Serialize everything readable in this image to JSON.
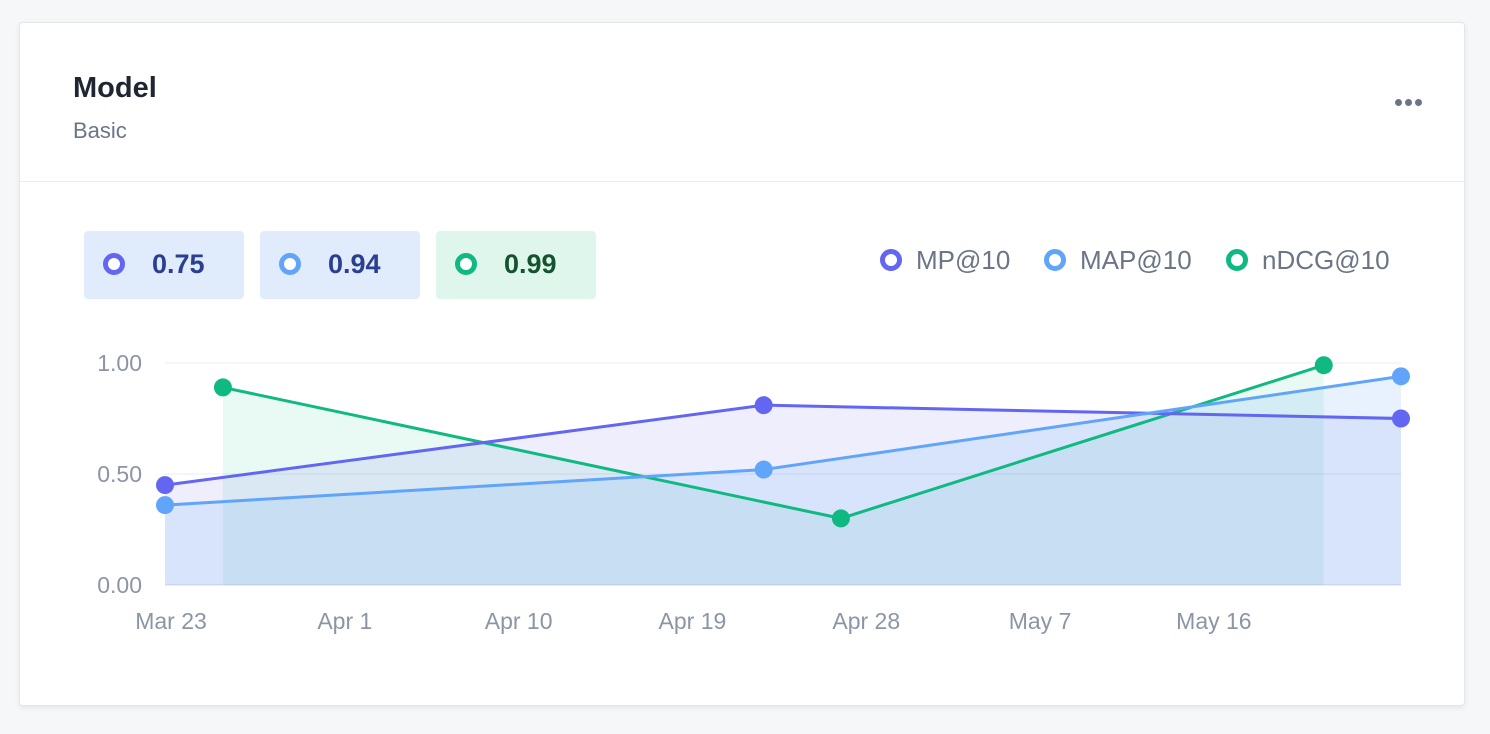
{
  "header": {
    "title": "Model",
    "subtitle": "Basic",
    "more_icon": "more-horizontal-icon"
  },
  "stat_pills": [
    {
      "value": "0.75",
      "color": "#6366f1",
      "bg": "#e0ebfb",
      "text_color": "#2a3f8f"
    },
    {
      "value": "0.94",
      "color": "#60a5fa",
      "bg": "#e0ebfb",
      "text_color": "#2a3f8f"
    },
    {
      "value": "0.99",
      "color": "#10b981",
      "bg": "#dff6ec",
      "text_color": "#14532d"
    }
  ],
  "legend": [
    {
      "label": "MP@10",
      "color": "#6366f1"
    },
    {
      "label": "MAP@10",
      "color": "#60a5fa"
    },
    {
      "label": "nDCG@10",
      "color": "#10b981"
    }
  ],
  "chart_data": {
    "type": "area",
    "x_ticks": [
      "Mar 23",
      "Apr 1",
      "Apr 10",
      "Apr 19",
      "Apr 28",
      "May 7",
      "May 16"
    ],
    "y_ticks": [
      "0.00",
      "0.50",
      "1.00"
    ],
    "ylim": [
      0,
      1
    ],
    "xlim": [
      "2023-03-23",
      "2023-05-26"
    ],
    "grid": true,
    "legend_position": "top-right",
    "series": [
      {
        "name": "MP@10",
        "color": "#6366f1",
        "points": [
          {
            "x": "2023-03-23",
            "y": 0.45
          },
          {
            "x": "2023-04-23",
            "y": 0.81
          },
          {
            "x": "2023-05-26",
            "y": 0.75
          }
        ]
      },
      {
        "name": "MAP@10",
        "color": "#60a5fa",
        "points": [
          {
            "x": "2023-03-23",
            "y": 0.36
          },
          {
            "x": "2023-04-23",
            "y": 0.52
          },
          {
            "x": "2023-05-26",
            "y": 0.94
          }
        ]
      },
      {
        "name": "nDCG@10",
        "color": "#10b981",
        "points": [
          {
            "x": "2023-03-26",
            "y": 0.89
          },
          {
            "x": "2023-04-27",
            "y": 0.3
          },
          {
            "x": "2023-05-22",
            "y": 0.99
          }
        ]
      }
    ]
  }
}
